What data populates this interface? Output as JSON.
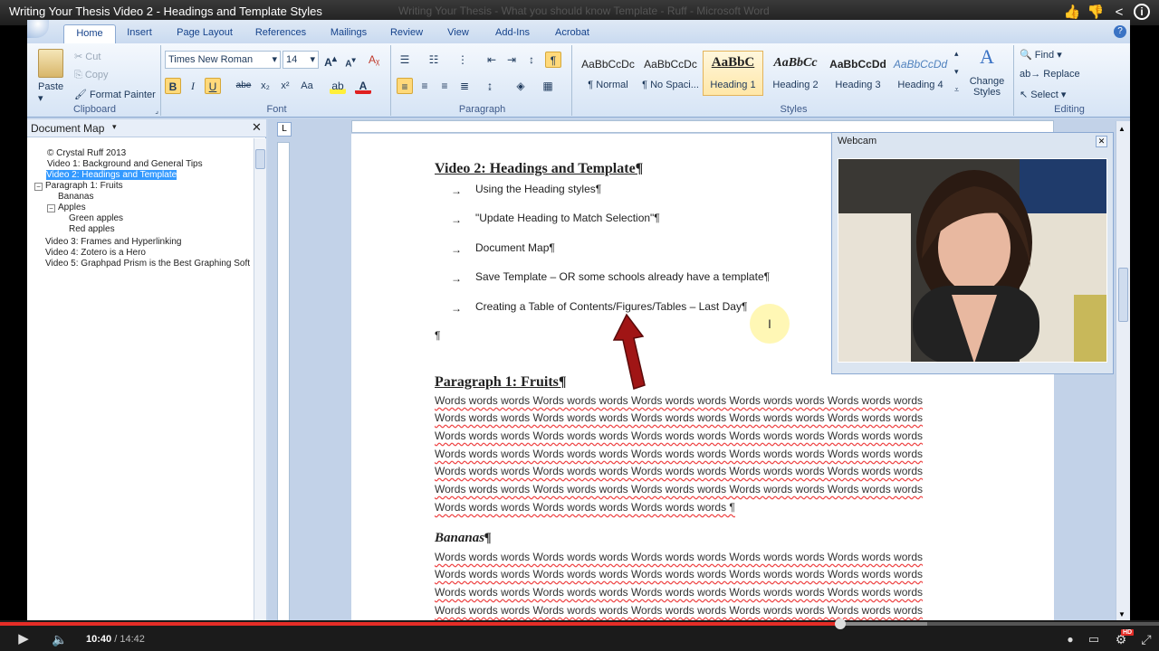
{
  "youtube": {
    "video_title": "Writing Your Thesis Video 2 - Headings and Template Styles",
    "current_time": "10:40",
    "duration": "14:42",
    "separator": "/",
    "progress_fraction": 0.725,
    "buffered_fraction": 0.8,
    "hd_badge": "HD",
    "accent_color": "#e52d27"
  },
  "word_window": {
    "title": "Writing Your Thesis - What you should know Template - Ruff - Microsoft Word"
  },
  "ribbon": {
    "tabs": [
      "Home",
      "Insert",
      "Page Layout",
      "References",
      "Mailings",
      "Review",
      "View",
      "Add-Ins",
      "Acrobat"
    ],
    "active_tab": "Home",
    "clipboard": {
      "label": "Clipboard",
      "paste": "Paste",
      "cut": "Cut",
      "copy": "Copy",
      "format_painter": "Format Painter"
    },
    "font": {
      "label": "Font",
      "family": "Times New Roman",
      "size": "14",
      "bold": "B",
      "italic": "I",
      "underline": "U",
      "strike": "abe",
      "subscript": "x₂",
      "superscript": "x²",
      "change_case": "Aa"
    },
    "paragraph": {
      "label": "Paragraph"
    },
    "styles": {
      "label": "Styles",
      "items": [
        {
          "preview": "AaBbCcDc",
          "name": "¶ Normal"
        },
        {
          "preview": "AaBbCcDc",
          "name": "¶ No Spaci..."
        },
        {
          "preview": "AaBbC",
          "name": "Heading 1"
        },
        {
          "preview": "AaBbCc",
          "name": "Heading 2"
        },
        {
          "preview": "AaBbCcDd",
          "name": "Heading 3"
        },
        {
          "preview": "AaBbCcDd",
          "name": "Heading 4"
        }
      ],
      "change_styles": "Change Styles"
    },
    "editing": {
      "label": "Editing",
      "find": "Find",
      "replace": "Replace",
      "select": "Select"
    }
  },
  "document_map": {
    "title": "Document Map",
    "items": [
      {
        "text": "© Crystal Ruff 2013"
      },
      {
        "text": "Video 1: Background and General Tips"
      },
      {
        "text": "Video 2: Headings and Template"
      },
      {
        "text": "Paragraph 1: Fruits"
      },
      {
        "text": "Bananas"
      },
      {
        "text": "Apples"
      },
      {
        "text": "Green apples"
      },
      {
        "text": "Red apples"
      },
      {
        "text": "Video 3: Frames and Hyperlinking"
      },
      {
        "text": "Video 4:  Zotero is a Hero"
      },
      {
        "text": "Video 5: Graphpad Prism is the Best Graphing Soft"
      }
    ]
  },
  "document": {
    "heading1": "Video 2: Headings and Template¶",
    "bullets": [
      "Using the Heading styles¶",
      "\"Update Heading to Match Selection\"¶",
      "Document Map¶",
      "Save Template – OR some schools already have a template¶",
      "Creating a Table of Contents/Figures/Tables – Last Day¶"
    ],
    "bullet_mark": "→",
    "empty_para": "¶",
    "heading_para": "Paragraph 1: Fruits¶",
    "words_line": "Words words words Words words words Words words words Words words words Words words words",
    "words_last": "Words words words Words words words Words words words ¶",
    "heading_bananas": "Bananas¶"
  },
  "webcam": {
    "title": "Webcam"
  }
}
